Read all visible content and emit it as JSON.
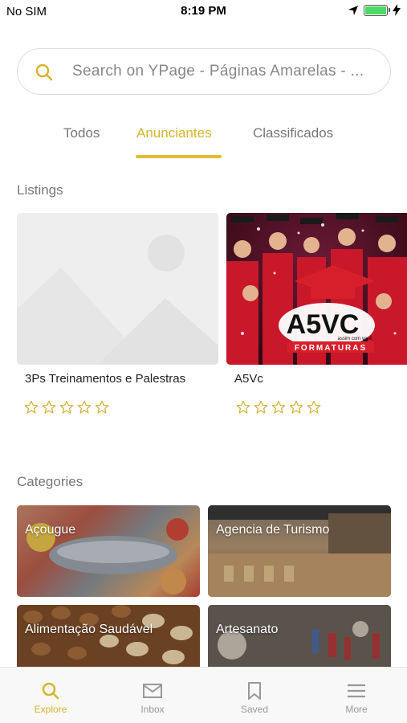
{
  "status_bar": {
    "carrier": "No SIM",
    "time": "8:19 PM",
    "battery_level": 1.0,
    "icons": [
      "location-arrow-icon",
      "battery-icon",
      "charging-bolt-icon"
    ]
  },
  "search": {
    "placeholder": "Search on YPage - Páginas Amarelas - ..."
  },
  "tabs": [
    {
      "label": "Todos",
      "active": false
    },
    {
      "label": "Anunciantes",
      "active": true
    },
    {
      "label": "Classificados",
      "active": false
    }
  ],
  "listings": {
    "title": "Listings",
    "items": [
      {
        "name": "3Ps Treinamentos e Palestras",
        "rating": 0,
        "image": "placeholder-image"
      },
      {
        "name": "A5Vc",
        "rating": 0,
        "image": "graduation-photo",
        "logo_text": "A5VC",
        "logo_tagline": "assim com você",
        "logo_banner": "FORMATURAS"
      }
    ]
  },
  "categories": {
    "title": "Categories",
    "items": [
      {
        "label": "Açougue"
      },
      {
        "label": "Agencia de Turismo"
      },
      {
        "label": "Alimentação Saudável"
      },
      {
        "label": "Artesanato"
      }
    ]
  },
  "colors": {
    "accent": "#d6b52e",
    "star_outline": "#d4b13a",
    "inactive_text": "#777777"
  },
  "bottom_nav": [
    {
      "label": "Explore",
      "icon": "search-icon",
      "active": true
    },
    {
      "label": "Inbox",
      "icon": "envelope-icon",
      "active": false
    },
    {
      "label": "Saved",
      "icon": "bookmark-icon",
      "active": false
    },
    {
      "label": "More",
      "icon": "menu-icon",
      "active": false
    }
  ]
}
